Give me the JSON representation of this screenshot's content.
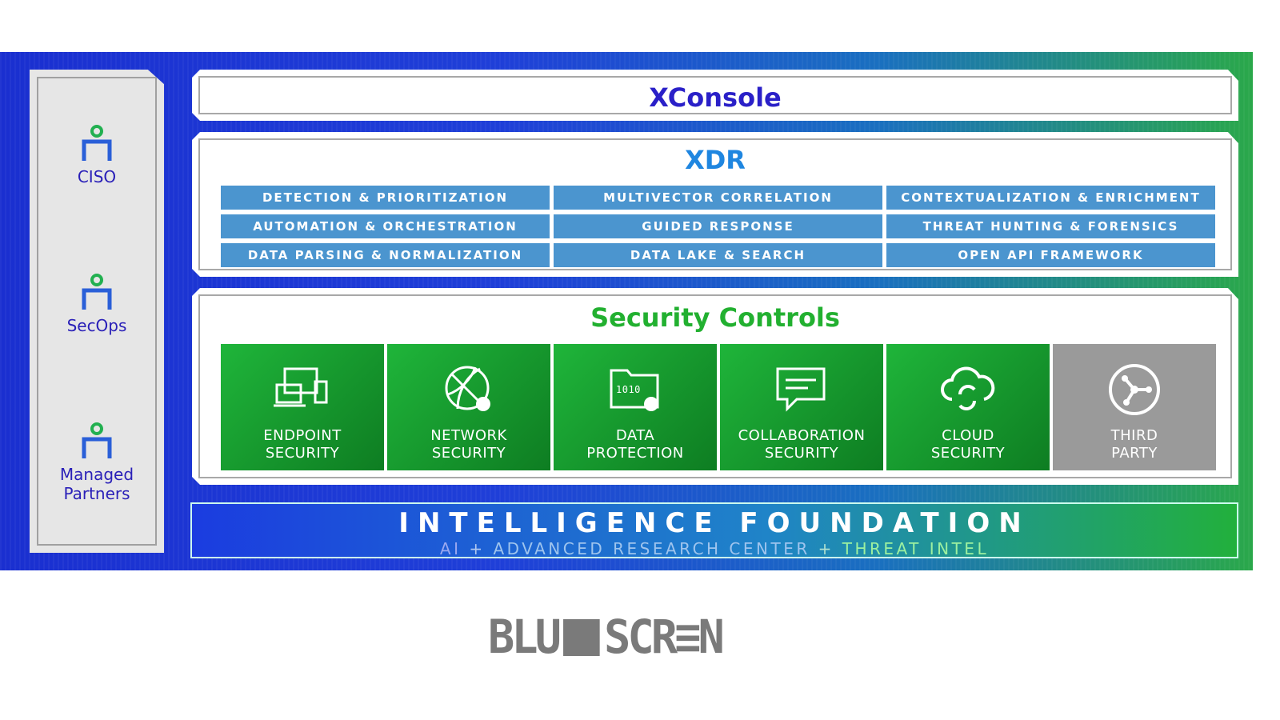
{
  "personas": [
    {
      "label": "CISO"
    },
    {
      "label": "SecOps"
    },
    {
      "label": "Managed Partners"
    }
  ],
  "xconsole": {
    "title": "XConsole"
  },
  "xdr": {
    "title": "XDR",
    "capabilities": [
      "DETECTION & PRIORITIZATION",
      "MULTIVECTOR CORRELATION",
      "CONTEXTUALIZATION & ENRICHMENT",
      "AUTOMATION & ORCHESTRATION",
      "GUIDED RESPONSE",
      "THREAT HUNTING & FORENSICS",
      "DATA PARSING & NORMALIZATION",
      "DATA LAKE & SEARCH",
      "OPEN API FRAMEWORK"
    ]
  },
  "security_controls": {
    "title": "Security Controls",
    "tiles": [
      {
        "l1": "ENDPOINT",
        "l2": "SECURITY",
        "icon": "endpoint-devices-icon"
      },
      {
        "l1": "NETWORK",
        "l2": "SECURITY",
        "icon": "network-globe-lock-icon"
      },
      {
        "l1": "DATA",
        "l2": "PROTECTION",
        "icon": "data-folder-lock-icon"
      },
      {
        "l1": "COLLABORATION",
        "l2": "SECURITY",
        "icon": "chat-message-icon"
      },
      {
        "l1": "CLOUD",
        "l2": "SECURITY",
        "icon": "cloud-sync-icon"
      },
      {
        "l1": "THIRD",
        "l2": "PARTY",
        "icon": "third-party-hub-icon"
      }
    ]
  },
  "foundation": {
    "title": "INTELLIGENCE FOUNDATION",
    "ai": "AI",
    "plus": "+",
    "arc": "ADVANCED RESEARCH CENTER",
    "threat": "THREAT INTEL"
  },
  "logo": {
    "text": "BLUESCREEN"
  },
  "colors": {
    "xconsole_title": "#2a20c8",
    "xdr_title": "#1f86e0",
    "security_title": "#22b030",
    "cell": "#4b95cf",
    "tile_green": "#15a02e",
    "tile_gray": "#9a9a9a"
  }
}
